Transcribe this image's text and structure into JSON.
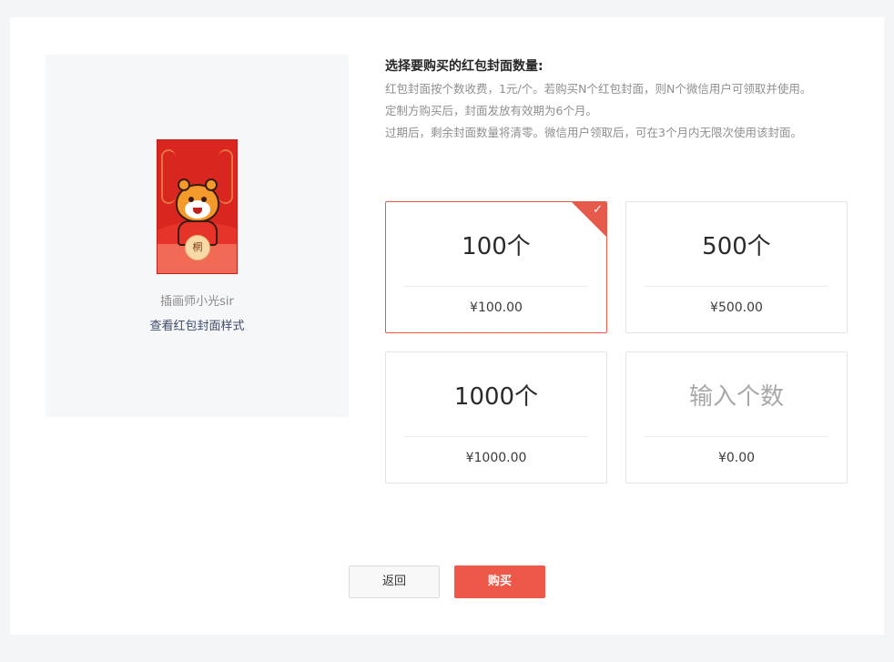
{
  "preview": {
    "cover_seal_text": "棢",
    "author": "插画师小光sir",
    "view_link": "查看红包封面样式"
  },
  "info": {
    "heading": "选择要购买的红包封面数量:",
    "desc_1": "红包封面按个数收费，1元/个。若购买N个红包封面，则N个微信用户可领取并使用。",
    "desc_2": "定制方购买后，封面发放有效期为6个月。",
    "desc_3": "过期后，剩余封面数量将清零。微信用户领取后，可在3个月内无限次使用该封面。"
  },
  "options": [
    {
      "count": "100个",
      "price": "¥100.00",
      "selected": true
    },
    {
      "count": "500个",
      "price": "¥500.00",
      "selected": false
    },
    {
      "count": "1000个",
      "price": "¥1000.00",
      "selected": false
    },
    {
      "count": "输入个数",
      "price": "¥0.00",
      "selected": false
    }
  ],
  "icons": {
    "check": "✓"
  },
  "buttons": {
    "back": "返回",
    "buy": "购买"
  },
  "colors": {
    "accent": "#ee5849",
    "envelope_red": "#d9261f"
  }
}
